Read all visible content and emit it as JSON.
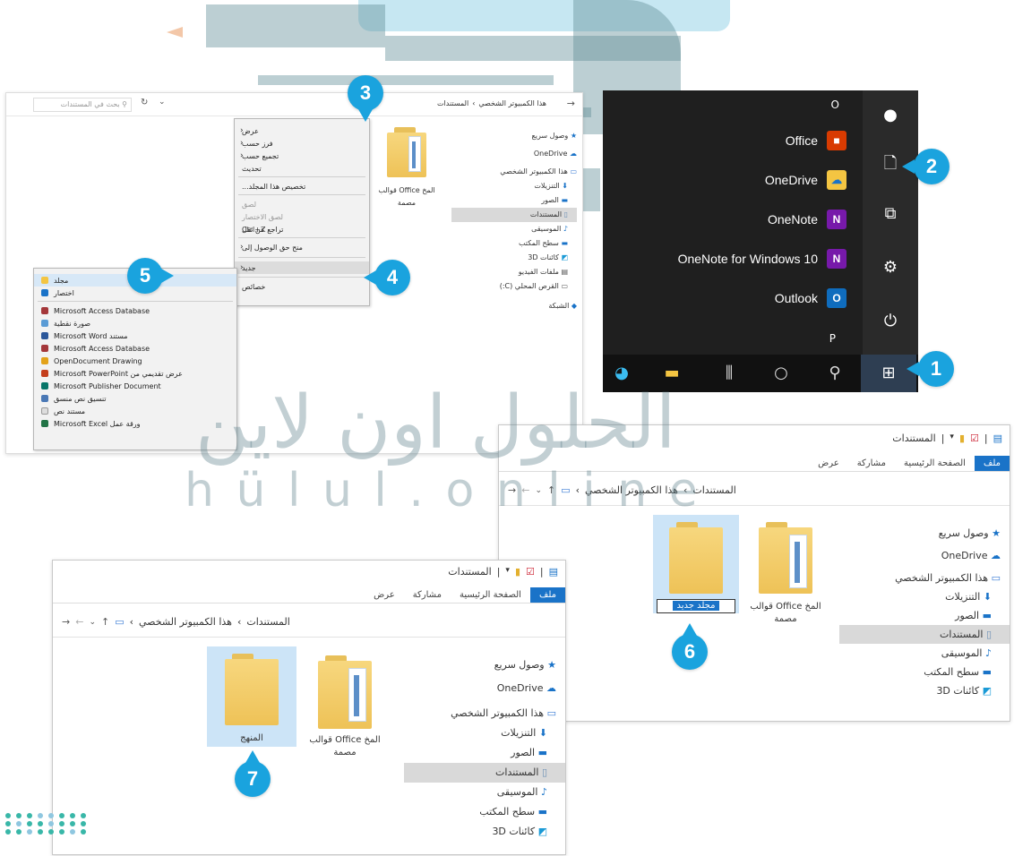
{
  "watermark": {
    "arabic": "الحلول اون لاين",
    "latin": "h ü l u l . o n l i n e"
  },
  "start_menu": {
    "top_letter": "O",
    "bottom_letter": "P",
    "apps": [
      "Office",
      "OneDrive",
      "OneNote",
      "OneNote for Windows 10",
      "Outlook"
    ],
    "colors": {
      "office": "#d83b01",
      "onedrive": "#f4c542",
      "onenote": "#7719aa",
      "outlook": "#0f6cbd"
    }
  },
  "badges": [
    "1",
    "2",
    "3",
    "4",
    "5",
    "6",
    "7"
  ],
  "win_a": {
    "breadcrumb": [
      "هذا الكمبيوتر الشخصي",
      "المستندات"
    ],
    "search_placeholder": "بحث في المستندات",
    "nav": [
      "وصول سريع",
      "OneDrive",
      "هذا الكمبيوتر الشخصي",
      "التنزيلات",
      "الصور",
      "المستندات",
      "الموسيقى",
      "سطح المكتب",
      "كائنات 3D",
      "ملفات الفيديو",
      "القرص المحلي (C:)",
      "الشبكة"
    ],
    "folder_label": "المخ Office قوالب مصمة",
    "context_menu": [
      "عرض",
      "فرز حسب",
      "تجميع حسب",
      "تحديث",
      "تخصيص هذا المجلد...",
      "لصق",
      "لصق الاختصار",
      "تراجع عن نقل",
      "منح حق الوصول إلى",
      "جديد",
      "خصائص"
    ],
    "undo_shortcut": "Ctrl+Z",
    "submenu": [
      "مجلد",
      "اختصار",
      "Microsoft Access Database",
      "صورة نقطية",
      "مستند Microsoft Word",
      "Microsoft Access Database",
      "OpenDocument Drawing",
      "عرض تقديمي من Microsoft PowerPoint",
      "Microsoft Publisher Document",
      "تنسيق نص منسق",
      "مستند نص",
      "ورقة عمل Microsoft Excel"
    ]
  },
  "win_b": {
    "title": "المستندات",
    "tabs": [
      "ملف",
      "الصفحة الرئيسية",
      "مشاركة",
      "عرض"
    ],
    "breadcrumb": [
      "هذا الكمبيوتر الشخصي",
      "المستندات"
    ],
    "nav": [
      "وصول سريع",
      "OneDrive",
      "هذا الكمبيوتر الشخصي",
      "التنزيلات",
      "الصور",
      "المستندات",
      "الموسيقى",
      "سطح المكتب",
      "كائنات 3D"
    ],
    "folder1_label": "المخ Office قوالب مصمة",
    "new_folder_input": "مجلد جديد"
  },
  "win_c": {
    "title": "المستندات",
    "tabs": [
      "ملف",
      "الصفحة الرئيسية",
      "مشاركة",
      "عرض"
    ],
    "breadcrumb": [
      "هذا الكمبيوتر الشخصي",
      "المستندات"
    ],
    "nav": [
      "وصول سريع",
      "OneDrive",
      "هذا الكمبيوتر الشخصي",
      "التنزيلات",
      "الصور",
      "المستندات",
      "الموسيقى",
      "سطح المكتب",
      "كائنات 3D"
    ],
    "folder1_label": "المخ Office قوالب مصمة",
    "folder2_label": "المنهج"
  }
}
